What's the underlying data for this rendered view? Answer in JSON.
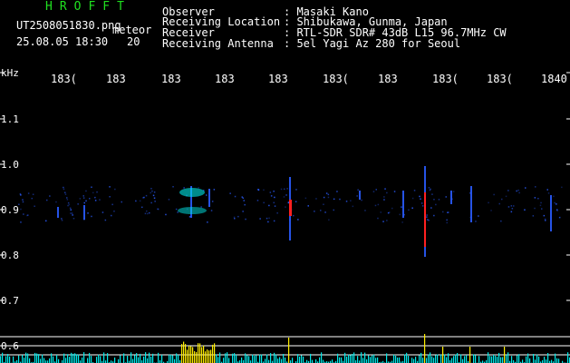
{
  "header": {
    "program": "HROFFT",
    "filename": "UT2508051830.png",
    "mode": "meteor",
    "datetime": "25.08.05 18:30",
    "count": "20"
  },
  "info": {
    "observer_label": "Observer",
    "observer_value": ": Masaki Kano",
    "location_label": "Receiving Location",
    "location_value": ": Shibukawa, Gunma, Japan",
    "receiver_label": "Receiver",
    "receiver_value": ": RTL-SDR SDR# 43dB L15 96.7MHz CW",
    "antenna_label": "Receiving Antenna",
    "antenna_value": ": 5el Yagi Az 280 for Seoul"
  },
  "axes": {
    "y_unit": "kHz",
    "x_ticks": [
      "183(",
      "183",
      "183",
      "183",
      "183",
      "183(",
      "183",
      "183(",
      "183(",
      "1840"
    ],
    "y_ticks": [
      "1.1",
      "1.0",
      "0.9",
      "0.8",
      "0.7",
      "0.6"
    ]
  },
  "colors": {
    "background": "#000000",
    "title_green": "#20e020",
    "grid_white": "#ffffff",
    "spectrum_cyan": "#00e8e8",
    "spectrum_yellow": "#ffee00",
    "echo_red": "#ff2020",
    "echo_blue": "#2a5cff"
  }
}
